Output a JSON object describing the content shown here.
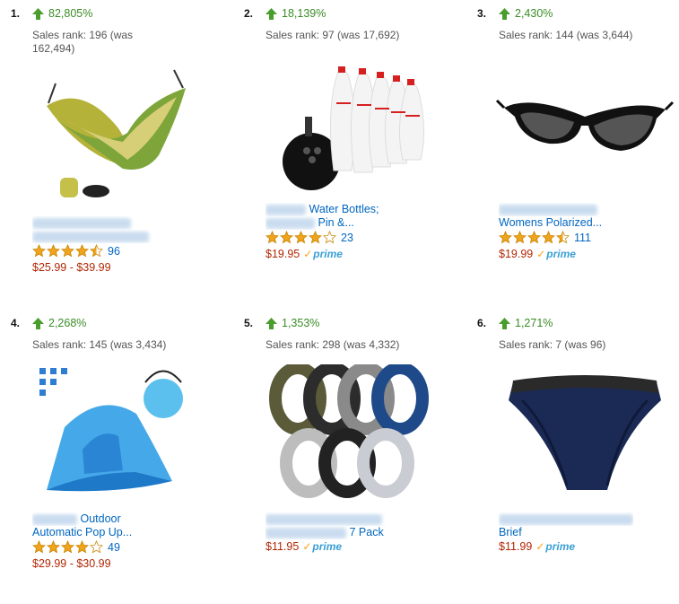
{
  "items": [
    {
      "rank": "1.",
      "pct": "82,805%",
      "sales": "Sales rank: 196 (was 162,494)",
      "title_lines": [
        "",
        ""
      ],
      "stars": 4.5,
      "reviews": "96",
      "price": "$25.99 - $39.99",
      "prime": false,
      "image": "hammock-icon"
    },
    {
      "rank": "2.",
      "pct": "18,139%",
      "sales": "Sales rank: 97 (was 17,692)",
      "title_lines": [
        "Water Bottles;",
        "Pin &..."
      ],
      "stars": 4,
      "reviews": "23",
      "price": "$19.95",
      "prime": true,
      "image": "bowling-bottles-icon"
    },
    {
      "rank": "3.",
      "pct": "2,430%",
      "sales": "Sales rank: 144 (was 3,644)",
      "title_lines": [
        "",
        "Womens Polarized..."
      ],
      "stars": 4.5,
      "reviews": "111",
      "price": "$19.99",
      "prime": true,
      "image": "sunglasses-icon"
    },
    {
      "rank": "4.",
      "pct": "2,268%",
      "sales": "Sales rank: 145 (was 3,434)",
      "title_lines": [
        "Outdoor",
        "Automatic Pop Up..."
      ],
      "stars": 4,
      "reviews": "49",
      "price": "$29.99 - $30.99",
      "prime": false,
      "image": "beach-tent-icon"
    },
    {
      "rank": "5.",
      "pct": "1,353%",
      "sales": "Sales rank: 298 (was 4,332)",
      "title_lines": [
        "",
        "7 Pack"
      ],
      "stars": 0,
      "reviews": "",
      "price": "$11.95",
      "prime": true,
      "image": "silicone-rings-icon"
    },
    {
      "rank": "6.",
      "pct": "1,271%",
      "sales": "Sales rank: 7 (was 96)",
      "title_lines": [
        "",
        "Brief"
      ],
      "stars": 0,
      "reviews": "",
      "price": "$11.99",
      "prime": true,
      "image": "brief-underwear-icon"
    }
  ],
  "prime_label": "prime",
  "colors": {
    "link": "#0066c0",
    "price": "#b12704",
    "up": "#3a8c25",
    "star": "#f0a31c",
    "prime": "#3a9fd6"
  }
}
